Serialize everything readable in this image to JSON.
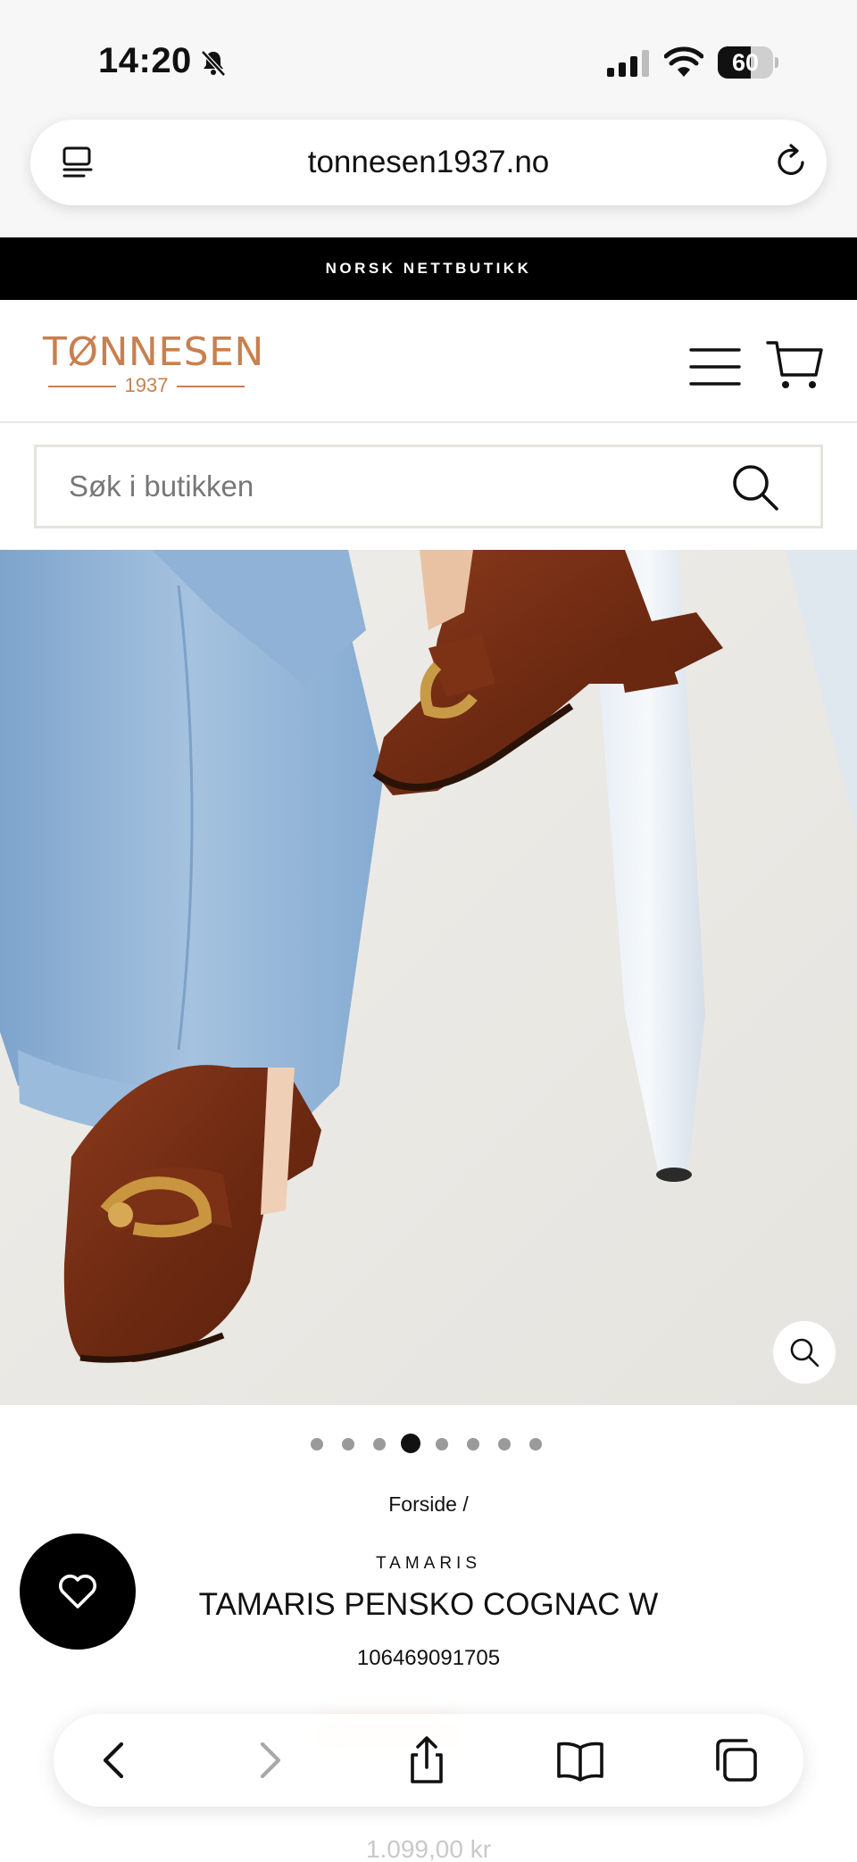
{
  "status_bar": {
    "time": "14:20",
    "battery": "60",
    "battery_level": 0.6
  },
  "browser": {
    "url": "tonnesen1937.no"
  },
  "announcement": "NORSK NETTBUTIKK",
  "header": {
    "logo_name": "TØNNESEN",
    "logo_year": "1937",
    "accent_color": "#c8804f"
  },
  "search": {
    "placeholder": "Søk i butikken"
  },
  "carousel": {
    "total_slides": 8,
    "active_index": 3
  },
  "product": {
    "breadcrumb": "Forside /",
    "brand": "TAMARIS",
    "title": "TAMARIS PENSKO COGNAC W",
    "sku": "106469091705",
    "price": "1.099,00 kr"
  },
  "icons": {
    "tabs": "tabs-icon",
    "reload": "reload-icon",
    "menu": "menu-icon",
    "cart": "cart-icon",
    "search": "search-icon",
    "zoom": "zoom-icon",
    "wishlist": "heart-icon",
    "back": "chevron-left-icon",
    "forward": "chevron-right-icon",
    "share": "share-icon",
    "bookmarks": "book-icon",
    "tab_switcher": "tabs-overview-icon"
  }
}
